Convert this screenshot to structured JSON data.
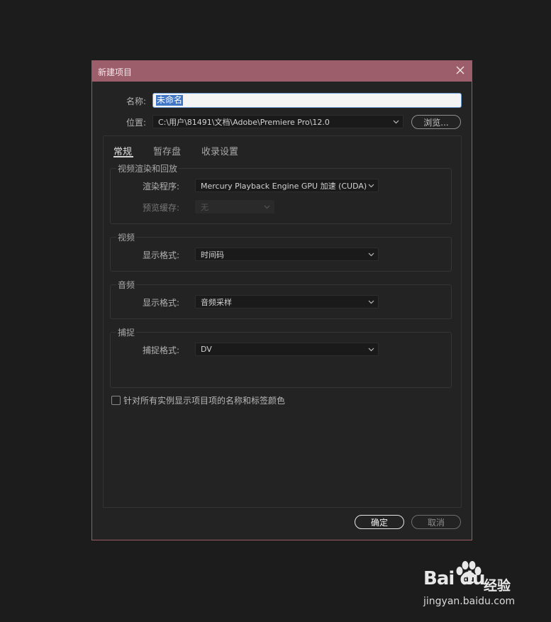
{
  "dialog": {
    "title": "新建项目",
    "name_label": "名称:",
    "name_value": "未命名",
    "location_label": "位置:",
    "location_value": "C:\\用户\\81491\\文档\\Adobe\\Premiere Pro\\12.0",
    "browse_label": "浏览...",
    "tabs": [
      "常规",
      "暂存盘",
      "收录设置"
    ],
    "active_tab": "常规",
    "groups": {
      "render": {
        "title": "视频渲染和回放",
        "renderer_label": "渲染程序:",
        "renderer_value": "Mercury Playback Engine GPU 加速 (CUDA)",
        "preview_label": "预览缓存:",
        "preview_value": "无"
      },
      "video": {
        "title": "视频",
        "format_label": "显示格式:",
        "format_value": "时间码"
      },
      "audio": {
        "title": "音频",
        "format_label": "显示格式:",
        "format_value": "音频采样"
      },
      "capture": {
        "title": "捕捉",
        "format_label": "捕捉格式:",
        "format_value": "DV"
      }
    },
    "checkbox_label": "针对所有实例显示项目项的名称和标签颜色",
    "checkbox_checked": false,
    "ok_label": "确定",
    "cancel_label": "取消"
  },
  "watermark": {
    "logo": "Bai du",
    "cn": "经验",
    "url": "jingyan.baidu.com"
  },
  "colors": {
    "titlebar": "#9c5e6a",
    "background": "#1c1c1c",
    "dialog": "#232323",
    "selection": "#3f76c6"
  },
  "icons": {
    "close": "close-icon",
    "dropdown": "chevron-down-icon",
    "watermark": "paw-icon"
  }
}
